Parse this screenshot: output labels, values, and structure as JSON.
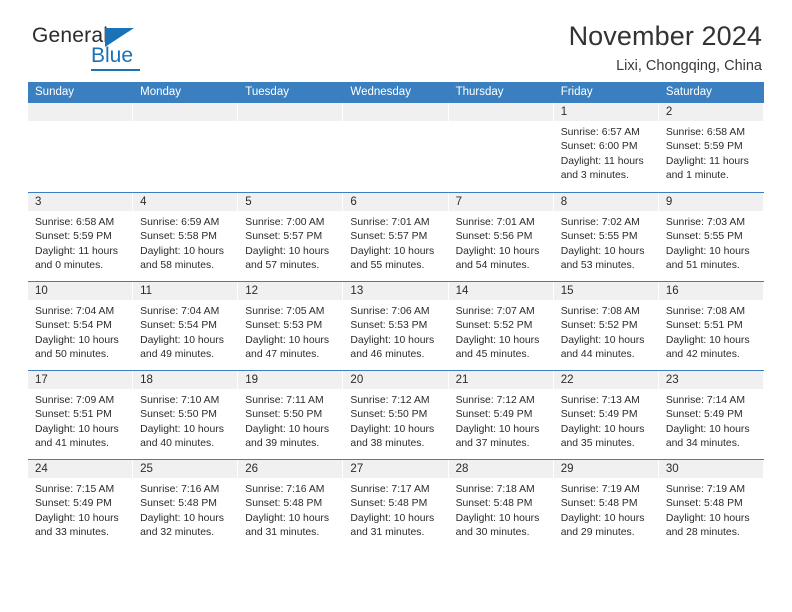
{
  "brand": {
    "name_part1": "General",
    "name_part2": "Blue",
    "accent_color": "#1a73b7"
  },
  "header": {
    "title": "November 2024",
    "subtitle": "Lixi, Chongqing, China"
  },
  "theme": {
    "header_row_color": "#3a80c1",
    "day_number_strip": "#f0f0f0",
    "text_color": "#2b2b2b"
  },
  "weekdays": [
    "Sunday",
    "Monday",
    "Tuesday",
    "Wednesday",
    "Thursday",
    "Friday",
    "Saturday"
  ],
  "weeks": [
    [
      {
        "day": "",
        "lines": []
      },
      {
        "day": "",
        "lines": []
      },
      {
        "day": "",
        "lines": []
      },
      {
        "day": "",
        "lines": []
      },
      {
        "day": "",
        "lines": []
      },
      {
        "day": "1",
        "lines": [
          "Sunrise: 6:57 AM",
          "Sunset: 6:00 PM",
          "Daylight: 11 hours",
          "and 3 minutes."
        ]
      },
      {
        "day": "2",
        "lines": [
          "Sunrise: 6:58 AM",
          "Sunset: 5:59 PM",
          "Daylight: 11 hours",
          "and 1 minute."
        ]
      }
    ],
    [
      {
        "day": "3",
        "lines": [
          "Sunrise: 6:58 AM",
          "Sunset: 5:59 PM",
          "Daylight: 11 hours",
          "and 0 minutes."
        ]
      },
      {
        "day": "4",
        "lines": [
          "Sunrise: 6:59 AM",
          "Sunset: 5:58 PM",
          "Daylight: 10 hours",
          "and 58 minutes."
        ]
      },
      {
        "day": "5",
        "lines": [
          "Sunrise: 7:00 AM",
          "Sunset: 5:57 PM",
          "Daylight: 10 hours",
          "and 57 minutes."
        ]
      },
      {
        "day": "6",
        "lines": [
          "Sunrise: 7:01 AM",
          "Sunset: 5:57 PM",
          "Daylight: 10 hours",
          "and 55 minutes."
        ]
      },
      {
        "day": "7",
        "lines": [
          "Sunrise: 7:01 AM",
          "Sunset: 5:56 PM",
          "Daylight: 10 hours",
          "and 54 minutes."
        ]
      },
      {
        "day": "8",
        "lines": [
          "Sunrise: 7:02 AM",
          "Sunset: 5:55 PM",
          "Daylight: 10 hours",
          "and 53 minutes."
        ]
      },
      {
        "day": "9",
        "lines": [
          "Sunrise: 7:03 AM",
          "Sunset: 5:55 PM",
          "Daylight: 10 hours",
          "and 51 minutes."
        ]
      }
    ],
    [
      {
        "day": "10",
        "lines": [
          "Sunrise: 7:04 AM",
          "Sunset: 5:54 PM",
          "Daylight: 10 hours",
          "and 50 minutes."
        ]
      },
      {
        "day": "11",
        "lines": [
          "Sunrise: 7:04 AM",
          "Sunset: 5:54 PM",
          "Daylight: 10 hours",
          "and 49 minutes."
        ]
      },
      {
        "day": "12",
        "lines": [
          "Sunrise: 7:05 AM",
          "Sunset: 5:53 PM",
          "Daylight: 10 hours",
          "and 47 minutes."
        ]
      },
      {
        "day": "13",
        "lines": [
          "Sunrise: 7:06 AM",
          "Sunset: 5:53 PM",
          "Daylight: 10 hours",
          "and 46 minutes."
        ]
      },
      {
        "day": "14",
        "lines": [
          "Sunrise: 7:07 AM",
          "Sunset: 5:52 PM",
          "Daylight: 10 hours",
          "and 45 minutes."
        ]
      },
      {
        "day": "15",
        "lines": [
          "Sunrise: 7:08 AM",
          "Sunset: 5:52 PM",
          "Daylight: 10 hours",
          "and 44 minutes."
        ]
      },
      {
        "day": "16",
        "lines": [
          "Sunrise: 7:08 AM",
          "Sunset: 5:51 PM",
          "Daylight: 10 hours",
          "and 42 minutes."
        ]
      }
    ],
    [
      {
        "day": "17",
        "lines": [
          "Sunrise: 7:09 AM",
          "Sunset: 5:51 PM",
          "Daylight: 10 hours",
          "and 41 minutes."
        ]
      },
      {
        "day": "18",
        "lines": [
          "Sunrise: 7:10 AM",
          "Sunset: 5:50 PM",
          "Daylight: 10 hours",
          "and 40 minutes."
        ]
      },
      {
        "day": "19",
        "lines": [
          "Sunrise: 7:11 AM",
          "Sunset: 5:50 PM",
          "Daylight: 10 hours",
          "and 39 minutes."
        ]
      },
      {
        "day": "20",
        "lines": [
          "Sunrise: 7:12 AM",
          "Sunset: 5:50 PM",
          "Daylight: 10 hours",
          "and 38 minutes."
        ]
      },
      {
        "day": "21",
        "lines": [
          "Sunrise: 7:12 AM",
          "Sunset: 5:49 PM",
          "Daylight: 10 hours",
          "and 37 minutes."
        ]
      },
      {
        "day": "22",
        "lines": [
          "Sunrise: 7:13 AM",
          "Sunset: 5:49 PM",
          "Daylight: 10 hours",
          "and 35 minutes."
        ]
      },
      {
        "day": "23",
        "lines": [
          "Sunrise: 7:14 AM",
          "Sunset: 5:49 PM",
          "Daylight: 10 hours",
          "and 34 minutes."
        ]
      }
    ],
    [
      {
        "day": "24",
        "lines": [
          "Sunrise: 7:15 AM",
          "Sunset: 5:49 PM",
          "Daylight: 10 hours",
          "and 33 minutes."
        ]
      },
      {
        "day": "25",
        "lines": [
          "Sunrise: 7:16 AM",
          "Sunset: 5:48 PM",
          "Daylight: 10 hours",
          "and 32 minutes."
        ]
      },
      {
        "day": "26",
        "lines": [
          "Sunrise: 7:16 AM",
          "Sunset: 5:48 PM",
          "Daylight: 10 hours",
          "and 31 minutes."
        ]
      },
      {
        "day": "27",
        "lines": [
          "Sunrise: 7:17 AM",
          "Sunset: 5:48 PM",
          "Daylight: 10 hours",
          "and 31 minutes."
        ]
      },
      {
        "day": "28",
        "lines": [
          "Sunrise: 7:18 AM",
          "Sunset: 5:48 PM",
          "Daylight: 10 hours",
          "and 30 minutes."
        ]
      },
      {
        "day": "29",
        "lines": [
          "Sunrise: 7:19 AM",
          "Sunset: 5:48 PM",
          "Daylight: 10 hours",
          "and 29 minutes."
        ]
      },
      {
        "day": "30",
        "lines": [
          "Sunrise: 7:19 AM",
          "Sunset: 5:48 PM",
          "Daylight: 10 hours",
          "and 28 minutes."
        ]
      }
    ]
  ]
}
